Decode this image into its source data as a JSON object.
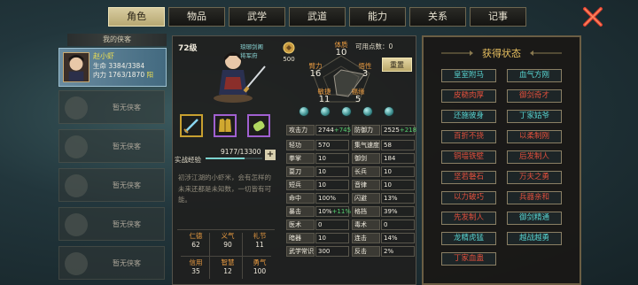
{
  "tabs": [
    {
      "label": "角色",
      "active": true
    },
    {
      "label": "物品"
    },
    {
      "label": "武学"
    },
    {
      "label": "武道"
    },
    {
      "label": "能力"
    },
    {
      "label": "关系"
    },
    {
      "label": "记事"
    }
  ],
  "left": {
    "header": "我的侠客",
    "hero": {
      "name": "赵小虾",
      "hp_label": "生命",
      "hp": "3384/3384",
      "mp_label": "内力",
      "mp": "1763/1870",
      "tag": "阳"
    },
    "empty_label": "暂无侠客"
  },
  "center": {
    "level": "72级",
    "title1": "琅琊剑阁",
    "title2": "将军府",
    "free_points_label": "可用点数：",
    "free_points": "0",
    "reset_label": "重置",
    "grade_value": "500",
    "attributes": {
      "tizhi_label": "体质",
      "tizhi": "10",
      "biji_label": "臂力",
      "biji": "16",
      "wuxing_label": "悟性",
      "wuxing": "3",
      "minjie_label": "敏捷",
      "minjie": "11",
      "fuyuan_label": "福缘",
      "fuyuan": "5"
    },
    "exp": {
      "label": "实战经验",
      "value": "9177/13300",
      "fraction": 0.69
    },
    "bio": "初涉江湖的小虾米，会有怎样的未来还都是未知数，一切皆有可能。",
    "virtues": [
      {
        "k": "仁德",
        "v": "62"
      },
      {
        "k": "义气",
        "v": "90"
      },
      {
        "k": "礼节",
        "v": "11"
      },
      {
        "k": "信用",
        "v": "35"
      },
      {
        "k": "智慧",
        "v": "12"
      },
      {
        "k": "勇气",
        "v": "100"
      }
    ],
    "stats_top": [
      {
        "k": "攻击力",
        "v": "2744",
        "b": "+745"
      },
      {
        "k": "防御力",
        "v": "2525",
        "b": "+218"
      }
    ],
    "stats": [
      [
        {
          "k": "轻功",
          "v": "570"
        },
        {
          "k": "集气速度",
          "v": "58"
        }
      ],
      [
        {
          "k": "拳掌",
          "v": "10"
        },
        {
          "k": "御剑",
          "v": "184"
        }
      ],
      [
        {
          "k": "耍刀",
          "v": "10"
        },
        {
          "k": "长兵",
          "v": "10"
        }
      ],
      [
        {
          "k": "短兵",
          "v": "10"
        },
        {
          "k": "音律",
          "v": "10"
        }
      ],
      [
        {
          "k": "命中",
          "v": "100%"
        },
        {
          "k": "闪避",
          "v": "13%"
        }
      ],
      [
        {
          "k": "暴击",
          "v": "10%",
          "b": "+11%"
        },
        {
          "k": "格挡",
          "v": "39%"
        }
      ],
      [
        {
          "k": "医术",
          "v": "0"
        },
        {
          "k": "毒术",
          "v": "0"
        }
      ],
      [
        {
          "k": "暗器",
          "v": "10"
        },
        {
          "k": "连击",
          "v": "14%"
        }
      ],
      [
        {
          "k": "武学常识",
          "v": "300"
        },
        {
          "k": "反击",
          "v": "2%"
        }
      ]
    ]
  },
  "right": {
    "title": "获得状态",
    "states": [
      {
        "label": "皇室附马",
        "red": false
      },
      {
        "label": "血气方刚",
        "red": false
      },
      {
        "label": "皮糙肉厚",
        "red": true
      },
      {
        "label": "御剑奇才",
        "red": true
      },
      {
        "label": "还施彼身",
        "red": false
      },
      {
        "label": "丁家姑爷",
        "red": false
      },
      {
        "label": "百折不挠",
        "red": true
      },
      {
        "label": "以柔制刚",
        "red": true
      },
      {
        "label": "铜墙铁壁",
        "red": true
      },
      {
        "label": "后发制人",
        "red": true
      },
      {
        "label": "坚若磐石",
        "red": true
      },
      {
        "label": "万夫之勇",
        "red": true
      },
      {
        "label": "以力破巧",
        "red": true
      },
      {
        "label": "兵器亲和",
        "red": true
      },
      {
        "label": "先发制人",
        "red": true
      },
      {
        "label": "御剑精通",
        "red": false
      },
      {
        "label": "龙精虎猛",
        "red": false
      },
      {
        "label": "越战越勇",
        "red": false
      },
      {
        "label": "丁家血蛊",
        "red": true
      }
    ]
  },
  "colors": {
    "accent_gold": "#d8cca0",
    "state_cyan": "#58d4d0",
    "state_red": "#e2503c",
    "attr_orange": "#e89a40"
  },
  "icons": [
    "close-x-icon",
    "sword-icon",
    "armor-icon",
    "jade-icon",
    "grade-icon",
    "pentagon-radar"
  ]
}
